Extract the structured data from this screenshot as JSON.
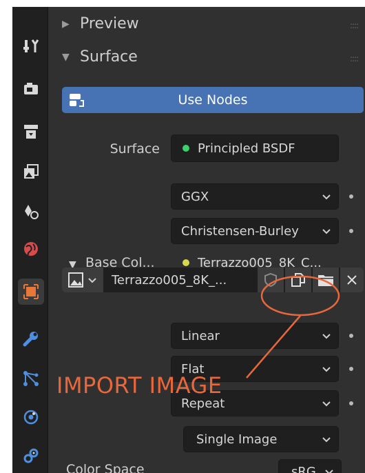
{
  "sidebar": {
    "tabs": [
      {
        "name": "tool",
        "icon": "tool-icon",
        "color": "#d8d8d8"
      },
      {
        "name": "render",
        "icon": "render-icon",
        "color": "#d8d8d8"
      },
      {
        "name": "output",
        "icon": "output-icon",
        "color": "#d8d8d8"
      },
      {
        "name": "view-layer",
        "icon": "view-layer-icon",
        "color": "#d8d8d8"
      },
      {
        "name": "scene",
        "icon": "scene-icon",
        "color": "#d8d8d8"
      },
      {
        "name": "world",
        "icon": "world-icon",
        "color": "#d94a4a"
      },
      {
        "name": "object",
        "icon": "object-icon",
        "color": "#e8783a"
      },
      {
        "name": "modifiers",
        "icon": "wrench-icon",
        "color": "#4f8fe0"
      },
      {
        "name": "particles",
        "icon": "particles-icon",
        "color": "#4f8fe0"
      },
      {
        "name": "physics",
        "icon": "physics-icon",
        "color": "#4f8fe0"
      },
      {
        "name": "constraints",
        "icon": "constraints-icon",
        "color": "#4f8fe0"
      }
    ]
  },
  "panels": {
    "preview": {
      "caret": "▶",
      "label": "Preview"
    },
    "surface": {
      "caret": "▼",
      "label": "Surface"
    }
  },
  "use_nodes": {
    "label": "Use Nodes",
    "icon": "node-material-icon"
  },
  "surface_row": {
    "label": "Surface",
    "value": "Principled BSDF",
    "socket_color": "#3bd16f"
  },
  "distribution": {
    "value": "GGX"
  },
  "subsurface": {
    "value": "Christensen-Burley"
  },
  "base_color": {
    "caret": "▼",
    "label": "Base Col...",
    "value": "Terrazzo005_8K_C...",
    "socket_color": "#d9d84a"
  },
  "image_bar": {
    "name": "Terrazzo005_8K_...",
    "icons": [
      "image-browse-icon",
      "fake-user-shield-icon",
      "duplicate-icon",
      "open-folder-icon",
      "unlink-x-icon"
    ]
  },
  "interpolation": {
    "value": "Linear"
  },
  "projection": {
    "value": "Flat"
  },
  "extension": {
    "value": "Repeat"
  },
  "source": {
    "value": "Single Image"
  },
  "color_space": {
    "label": "Color Space",
    "value": "sRG"
  },
  "annotation": {
    "text": "IMPORT IMAGE",
    "color": "#e8683c"
  },
  "colors": {
    "panel_bg": "#303030",
    "field_bg": "#1f1f1f",
    "accent_blue": "#4772b3",
    "annotation_orange": "#e8683c"
  }
}
